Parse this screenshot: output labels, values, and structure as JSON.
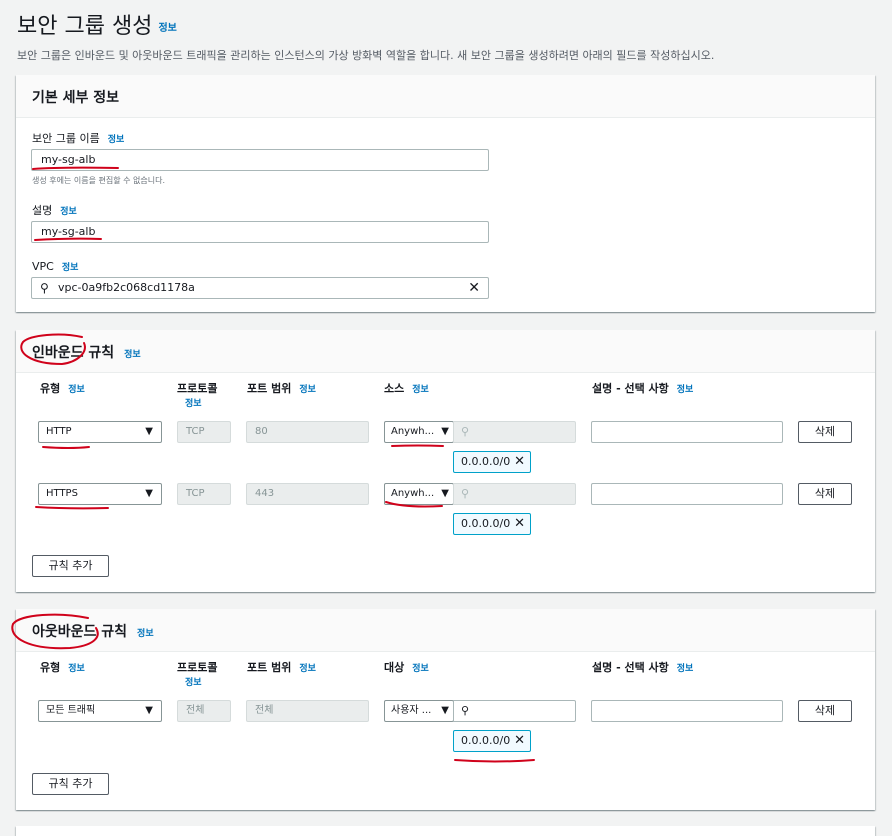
{
  "page": {
    "title": "보안 그룹 생성",
    "title_info": "정보",
    "description": "보안 그룹은 인바운드 및 아웃바운드 트래픽을 관리하는 인스턴스의 가상 방화벽 역할을 합니다. 새 보안 그룹을 생성하려면 아래의 필드를 작성하십시오."
  },
  "basic": {
    "heading": "기본 세부 정보",
    "name_label": "보안 그룹 이름",
    "name_info": "정보",
    "name_value": "my-sg-alb",
    "name_hint": "생성 후에는 이름을 편집할 수 없습니다.",
    "desc_label": "설명",
    "desc_info": "정보",
    "desc_value": "my-sg-alb",
    "vpc_label": "VPC",
    "vpc_info": "정보",
    "vpc_value": "vpc-0a9fb2c068cd1178a"
  },
  "inbound": {
    "heading": "인바운드 규칙",
    "heading_info": "정보",
    "columns": {
      "type": "유형",
      "type_info": "정보",
      "protocol": "프로토콜",
      "protocol_info": "정보",
      "port": "포트 범위",
      "port_info": "정보",
      "source": "소스",
      "source_info": "정보",
      "desc": "설명 - 선택 사항",
      "desc_info": "정보"
    },
    "rules": [
      {
        "type": "HTTP",
        "protocol": "TCP",
        "port": "80",
        "source": "Anywh...",
        "cidr": "0.0.0.0/0",
        "delete": "삭제"
      },
      {
        "type": "HTTPS",
        "protocol": "TCP",
        "port": "443",
        "source": "Anywh...",
        "cidr": "0.0.0.0/0",
        "delete": "삭제"
      }
    ],
    "add_rule": "규칙 추가"
  },
  "outbound": {
    "heading": "아웃바운드 규칙",
    "heading_info": "정보",
    "columns": {
      "type": "유형",
      "type_info": "정보",
      "protocol": "프로토콜",
      "protocol_info": "정보",
      "port": "포트 범위",
      "port_info": "정보",
      "dest": "대상",
      "dest_info": "정보",
      "desc": "설명 - 선택 사항",
      "desc_info": "정보"
    },
    "rules": [
      {
        "type": "모든 트래픽",
        "protocol": "전체",
        "port": "전체",
        "dest": "사용자 ...",
        "cidr": "0.0.0.0/0",
        "delete": "삭제"
      }
    ],
    "add_rule": "규칙 추가"
  },
  "icons": {
    "search": "search-icon",
    "clear": "close-icon",
    "dropdown": "caret-down-icon",
    "remove": "close-icon"
  },
  "colors": {
    "link": "#0073bb",
    "annotation": "#d0021b",
    "chip_border": "#00a1c9"
  }
}
